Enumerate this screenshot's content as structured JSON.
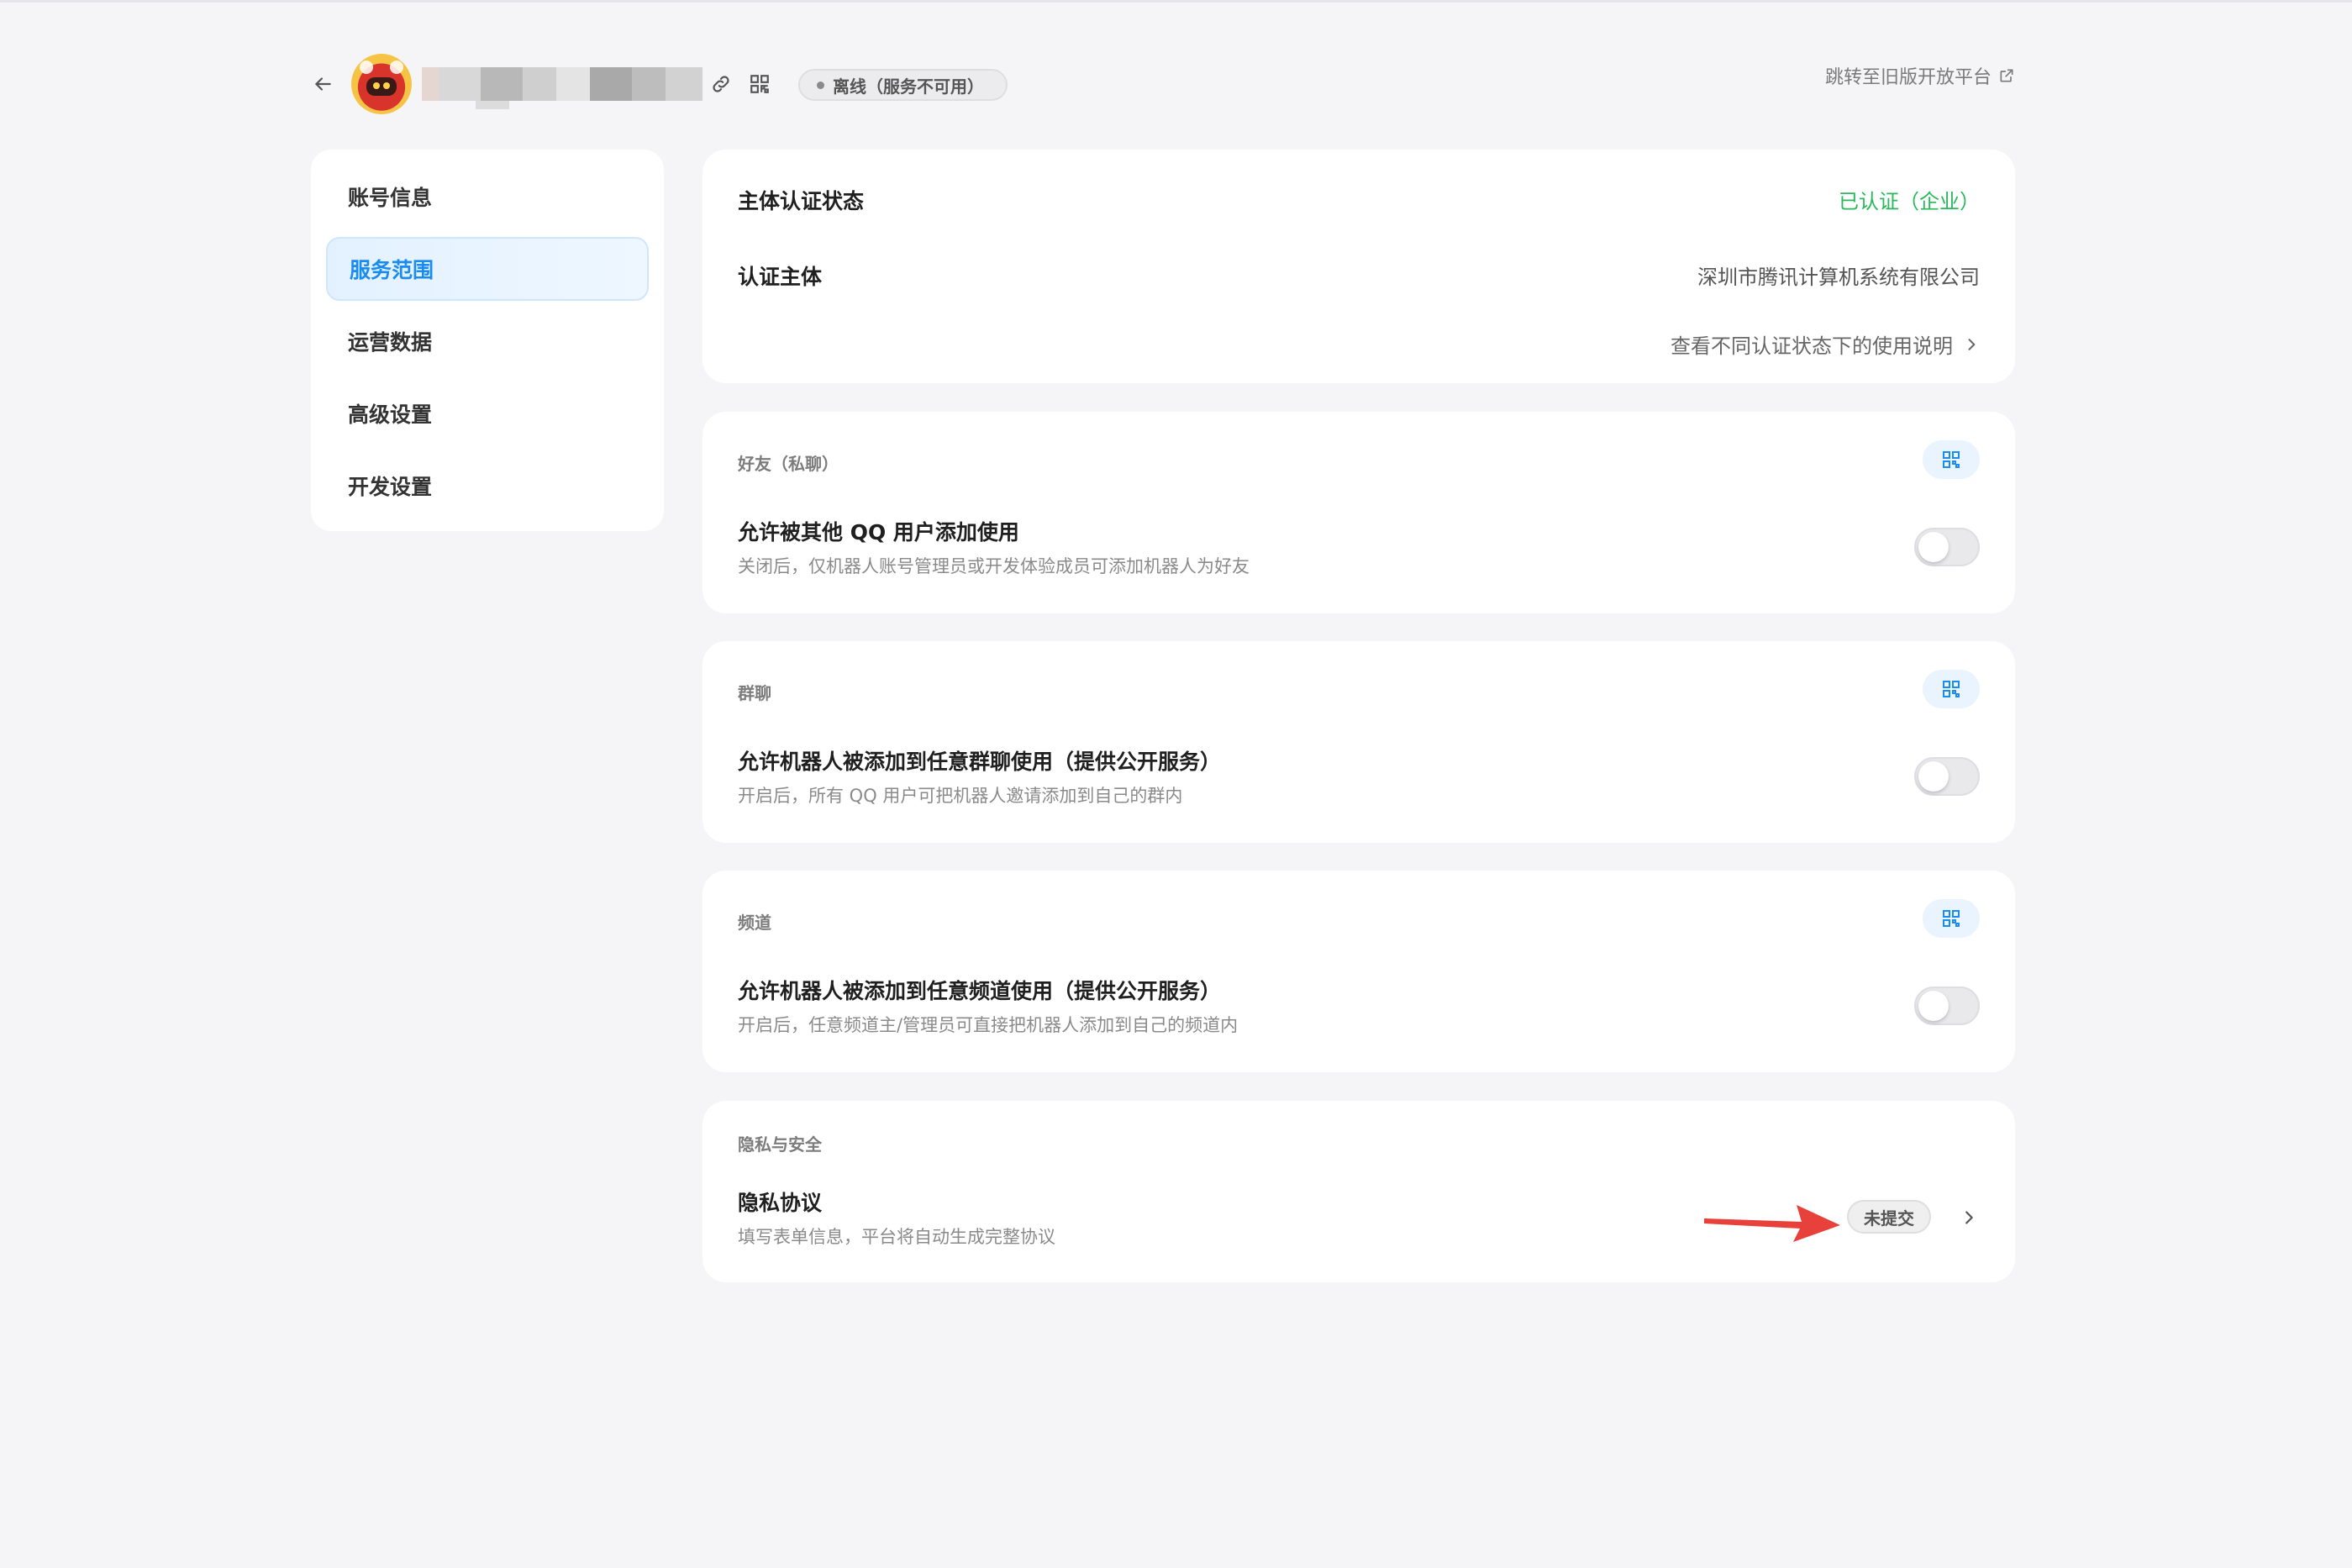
{
  "header": {
    "status_label": "离线（服务不可用）",
    "old_platform_link": "跳转至旧版开放平台"
  },
  "sidebar": {
    "items": [
      {
        "label": "账号信息",
        "active": false
      },
      {
        "label": "服务范围",
        "active": true
      },
      {
        "label": "运营数据",
        "active": false
      },
      {
        "label": "高级设置",
        "active": false
      },
      {
        "label": "开发设置",
        "active": false
      }
    ]
  },
  "verification": {
    "status_label": "主体认证状态",
    "status_value": "已认证（企业）",
    "entity_label": "认证主体",
    "entity_value": "深圳市腾讯计算机系统有限公司",
    "usage_link": "查看不同认证状态下的使用说明"
  },
  "friends": {
    "section_title": "好友（私聊）",
    "setting_title": "允许被其他 QQ 用户添加使用",
    "setting_desc": "关闭后，仅机器人账号管理员或开发体验成员可添加机器人为好友",
    "enabled": false
  },
  "group": {
    "section_title": "群聊",
    "setting_title": "允许机器人被添加到任意群聊使用（提供公开服务）",
    "setting_desc": "开启后，所有 QQ 用户可把机器人邀请添加到自己的群内",
    "enabled": false
  },
  "channel": {
    "section_title": "频道",
    "setting_title": "允许机器人被添加到任意频道使用（提供公开服务）",
    "setting_desc": "开启后，任意频道主/管理员可直接把机器人添加到自己的频道内",
    "enabled": false
  },
  "privacy": {
    "section_title": "隐私与安全",
    "setting_title": "隐私协议",
    "setting_desc": "填写表单信息，平台将自动生成完整协议",
    "status_badge": "未提交"
  },
  "colors": {
    "accent": "#1a8cf0",
    "verified": "#27b85a",
    "annotation": "#e8403a"
  }
}
